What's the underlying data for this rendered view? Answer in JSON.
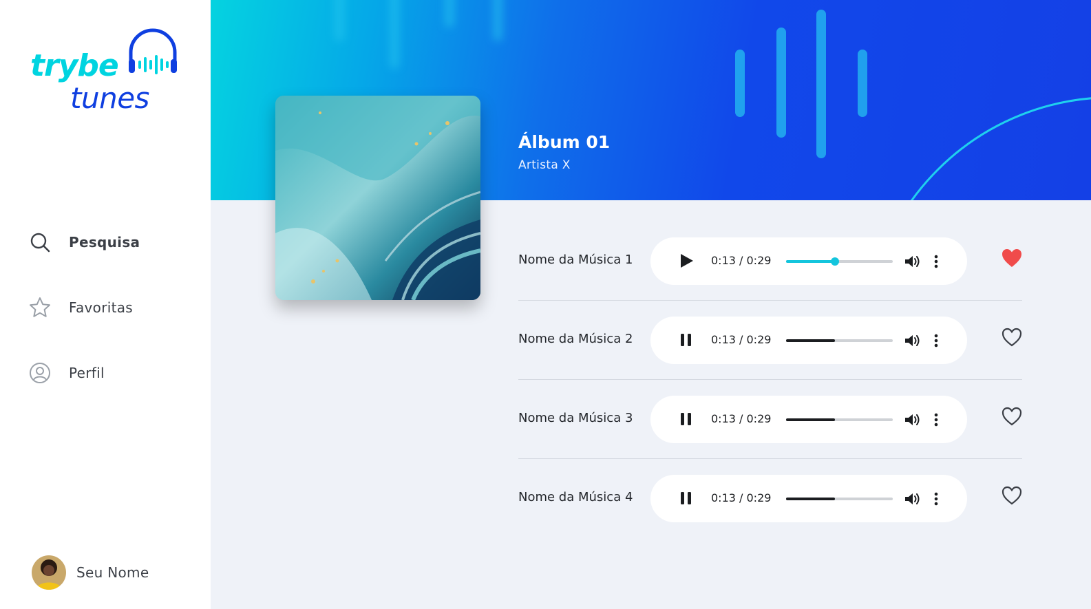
{
  "app": {
    "logo_line1": "trybe",
    "logo_line2": "tunes",
    "brand_colors": {
      "cyan": "#00d4e0",
      "blue": "#0f3fe0"
    }
  },
  "sidebar": {
    "items": [
      {
        "label": "Pesquisa",
        "icon": "search-icon",
        "active": true
      },
      {
        "label": "Favoritas",
        "icon": "star-icon",
        "active": false
      },
      {
        "label": "Perfil",
        "icon": "user-circle-icon",
        "active": false
      }
    ],
    "user": {
      "name": "Seu Nome",
      "icon": "avatar"
    }
  },
  "album": {
    "title": "Álbum 01",
    "artist": "Artista X"
  },
  "tracks": [
    {
      "name": "Nome da Música 1",
      "state": "paused-play-icon",
      "time": "0:13 / 0:29",
      "progress": 0.46,
      "active": true,
      "favorite": true
    },
    {
      "name": "Nome da Música 2",
      "state": "pause-icon",
      "time": "0:13 / 0:29",
      "progress": 0.46,
      "active": false,
      "favorite": false
    },
    {
      "name": "Nome da Música 3",
      "state": "pause-icon",
      "time": "0:13 / 0:29",
      "progress": 0.46,
      "active": false,
      "favorite": false
    },
    {
      "name": "Nome da Música 4",
      "state": "pause-icon",
      "time": "0:13 / 0:29",
      "progress": 0.46,
      "active": false,
      "favorite": false
    }
  ],
  "colors": {
    "accent": "#14c5dd",
    "favorite": "#f04b4b",
    "background": "#eff2f8"
  }
}
